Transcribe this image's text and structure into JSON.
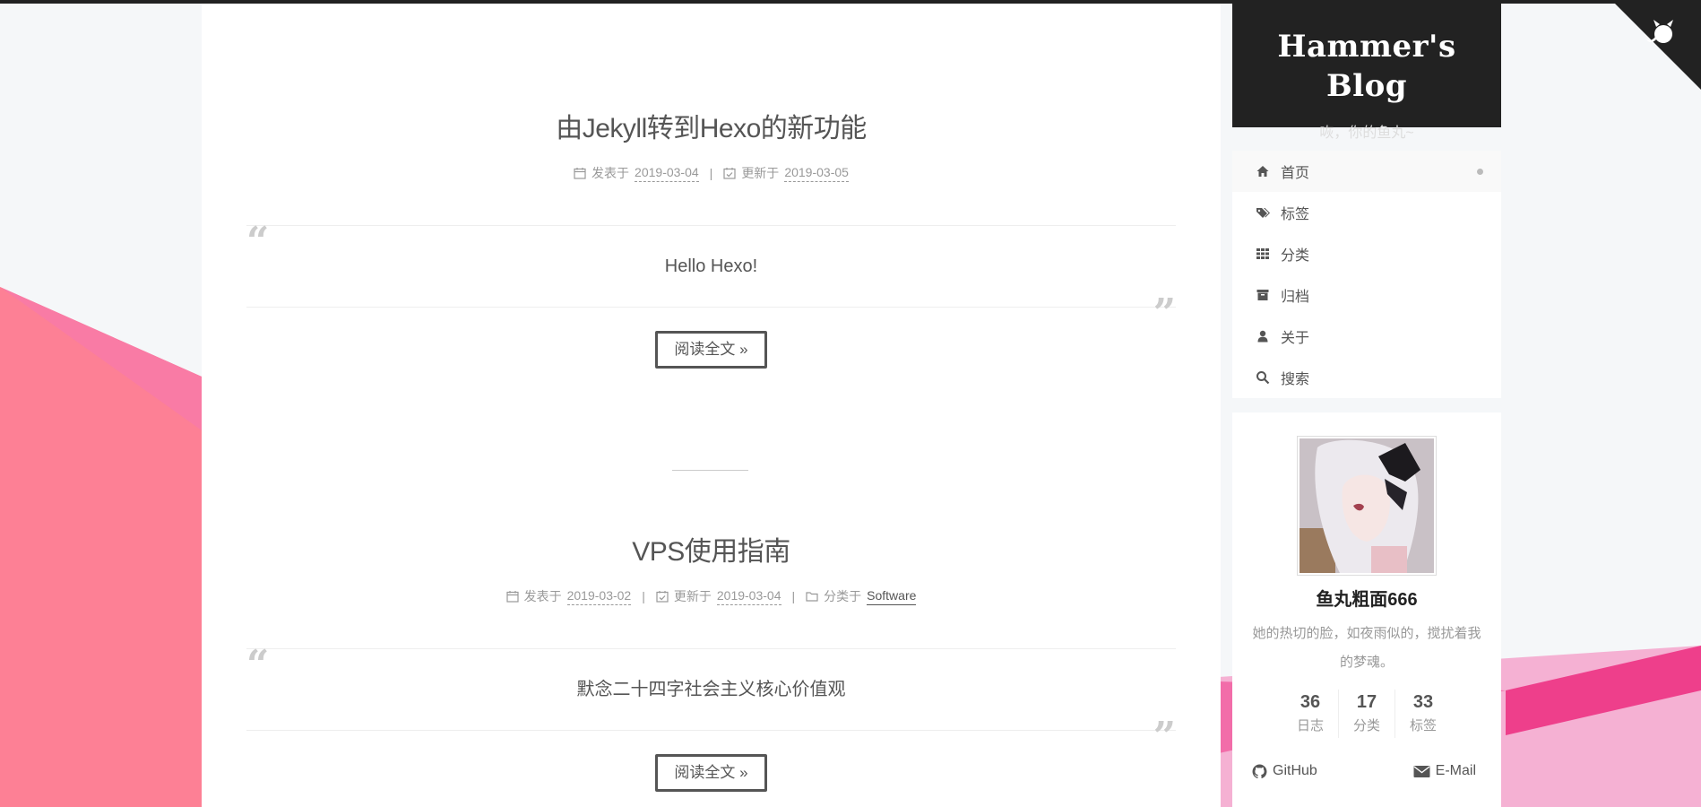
{
  "colors": {
    "accent_pink": "#fb7da0",
    "dark": "#222222",
    "text": "#555555",
    "muted": "#999999"
  },
  "posts": [
    {
      "title": "由Jekyll转到Hexo的新功能",
      "published_label": "发表于",
      "published_date": "2019-03-04",
      "updated_label": "更新于",
      "updated_date": "2019-03-05",
      "excerpt": "Hello Hexo!",
      "read_more": "阅读全文 »"
    },
    {
      "title": "VPS使用指南",
      "published_label": "发表于",
      "published_date": "2019-03-02",
      "updated_label": "更新于",
      "updated_date": "2019-03-04",
      "category_label": "分类于",
      "category": "Software",
      "excerpt": "默念二十四字社会主义核心价值观",
      "read_more": "阅读全文 »"
    }
  ],
  "meta_separator": "|",
  "sidebar": {
    "site_title": "Hammer's Blog",
    "site_subtitle": "咴，你的鱼丸~",
    "menu": [
      {
        "label": "首页",
        "icon": "home-icon"
      },
      {
        "label": "标签",
        "icon": "tags-icon"
      },
      {
        "label": "分类",
        "icon": "grid-icon"
      },
      {
        "label": "归档",
        "icon": "archive-icon"
      },
      {
        "label": "关于",
        "icon": "user-icon"
      },
      {
        "label": "搜索",
        "icon": "search-icon"
      }
    ],
    "author": {
      "name": "鱼丸粗面666",
      "description": "她的热切的脸，如夜雨似的，搅扰着我的梦魂。"
    },
    "stats": [
      {
        "count": "36",
        "label": "日志"
      },
      {
        "count": "17",
        "label": "分类"
      },
      {
        "count": "33",
        "label": "标签"
      }
    ],
    "links": [
      {
        "label": "GitHub",
        "icon": "github-icon"
      },
      {
        "label": "E-Mail",
        "icon": "envelope-icon"
      }
    ]
  },
  "corner_icon": "github-octocat-icon"
}
